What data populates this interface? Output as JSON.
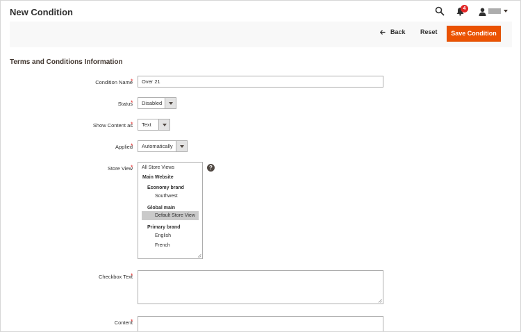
{
  "page": {
    "title": "New Condition"
  },
  "header": {
    "notifications_count": "4",
    "icons": [
      "search-icon",
      "bell-icon",
      "user-icon",
      "chevron-down-icon"
    ]
  },
  "actions": {
    "back_label": "Back",
    "reset_label": "Reset",
    "save_label": "Save Condition"
  },
  "section": {
    "title": "Terms and Conditions Information"
  },
  "form": {
    "condition_name": {
      "label": "Condition Name",
      "value": "Over 21"
    },
    "status": {
      "label": "Status",
      "value": "Disabled"
    },
    "show_content_as": {
      "label": "Show Content as",
      "value": "Text"
    },
    "applied": {
      "label": "Applied",
      "value": "Automatically"
    },
    "store_view": {
      "label": "Store View",
      "options": {
        "all": "All Store Views",
        "main_website": "Main Website",
        "economy_brand": "Economy brand",
        "southwest": "Southwest",
        "global_main": "Global main",
        "default_store_view": "Default Store View",
        "primary_brand": "Primary brand",
        "english": "English",
        "french": "French"
      },
      "selected": "Default Store View"
    },
    "checkbox_text": {
      "label": "Checkbox Text",
      "value": ""
    },
    "content": {
      "label": "Content",
      "value": ""
    },
    "required_mark": "*"
  },
  "colors": {
    "accent": "#eb5202",
    "required": "#e22626",
    "badge": "#e22626",
    "action_bar_bg": "#f8f8f8"
  }
}
